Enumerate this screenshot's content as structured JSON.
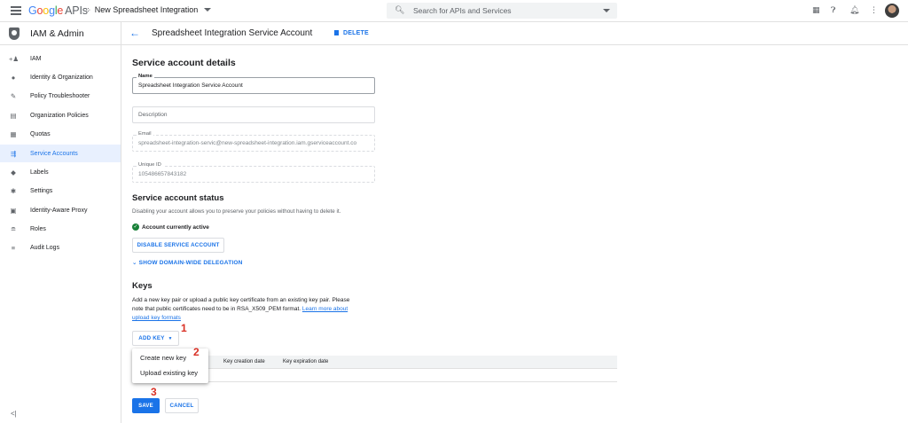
{
  "topbar": {
    "logo_letters": [
      "G",
      "o",
      "o",
      "g",
      "l",
      "e"
    ],
    "logo_suffix": "APIs",
    "project_name": "New Spreadsheet Integration",
    "search_placeholder": "Search for APIs and Services",
    "icons": [
      "gift-icon",
      "help-icon",
      "bell-icon",
      "more-vert-icon"
    ]
  },
  "sidebar": {
    "title": "IAM & Admin",
    "items": [
      {
        "label": "IAM",
        "icon": "person-add-icon",
        "glyph": "+♟"
      },
      {
        "label": "Identity & Organization",
        "icon": "account-circle-icon",
        "glyph": "●"
      },
      {
        "label": "Policy Troubleshooter",
        "icon": "wrench-icon",
        "glyph": "✎"
      },
      {
        "label": "Organization Policies",
        "icon": "policy-doc-icon",
        "glyph": "▤"
      },
      {
        "label": "Quotas",
        "icon": "quota-icon",
        "glyph": "▦"
      },
      {
        "label": "Service Accounts",
        "icon": "service-account-icon",
        "glyph": "⇶"
      },
      {
        "label": "Labels",
        "icon": "label-icon",
        "glyph": "◆"
      },
      {
        "label": "Settings",
        "icon": "gear-icon",
        "glyph": "✱"
      },
      {
        "label": "Identity-Aware Proxy",
        "icon": "proxy-icon",
        "glyph": "▣"
      },
      {
        "label": "Roles",
        "icon": "roles-icon",
        "glyph": "≘"
      },
      {
        "label": "Audit Logs",
        "icon": "list-icon",
        "glyph": "≡"
      }
    ],
    "active_index": 5,
    "collapse_glyph": "<|"
  },
  "header": {
    "title": "Spreadsheet Integration Service Account",
    "delete_label": "DELETE"
  },
  "details": {
    "heading": "Service account details",
    "name_label": "Name",
    "name_value": "Spreadsheet Integration Service Account",
    "description_placeholder": "Description",
    "email_label": "Email",
    "email_value": "spreadsheet-integration-servic@new-spreadsheet-integration.iam.gserviceaccount.co",
    "unique_id_label": "Unique ID",
    "unique_id_value": "105486657843182"
  },
  "status": {
    "heading": "Service account status",
    "description": "Disabling your account allows you to preserve your policies without having to delete it.",
    "active_text": "Account currently active",
    "disable_button": "DISABLE SERVICE ACCOUNT",
    "delegation_link": "SHOW DOMAIN-WIDE DELEGATION"
  },
  "keys": {
    "heading": "Keys",
    "desc_line1": "Add a new key pair or upload a public key certificate from an existing key pair. Please",
    "desc_line2": "note that public certificates need to be in RSA_X509_PEM format.",
    "learn_more_1": "Learn more about",
    "learn_more_2": "upload key formats",
    "add_key_button": "ADD KEY",
    "menu": [
      "Create new key",
      "Upload existing key"
    ],
    "columns": [
      "Key creation date",
      "Key expiration date"
    ]
  },
  "footer": {
    "save_label": "SAVE",
    "cancel_label": "CANCEL"
  },
  "annotations": [
    "1",
    "2",
    "3"
  ],
  "colors": {
    "accent": "#1a73e8",
    "active_bg": "#e8f0fe",
    "annotation": "#d93025",
    "success": "#188038"
  }
}
